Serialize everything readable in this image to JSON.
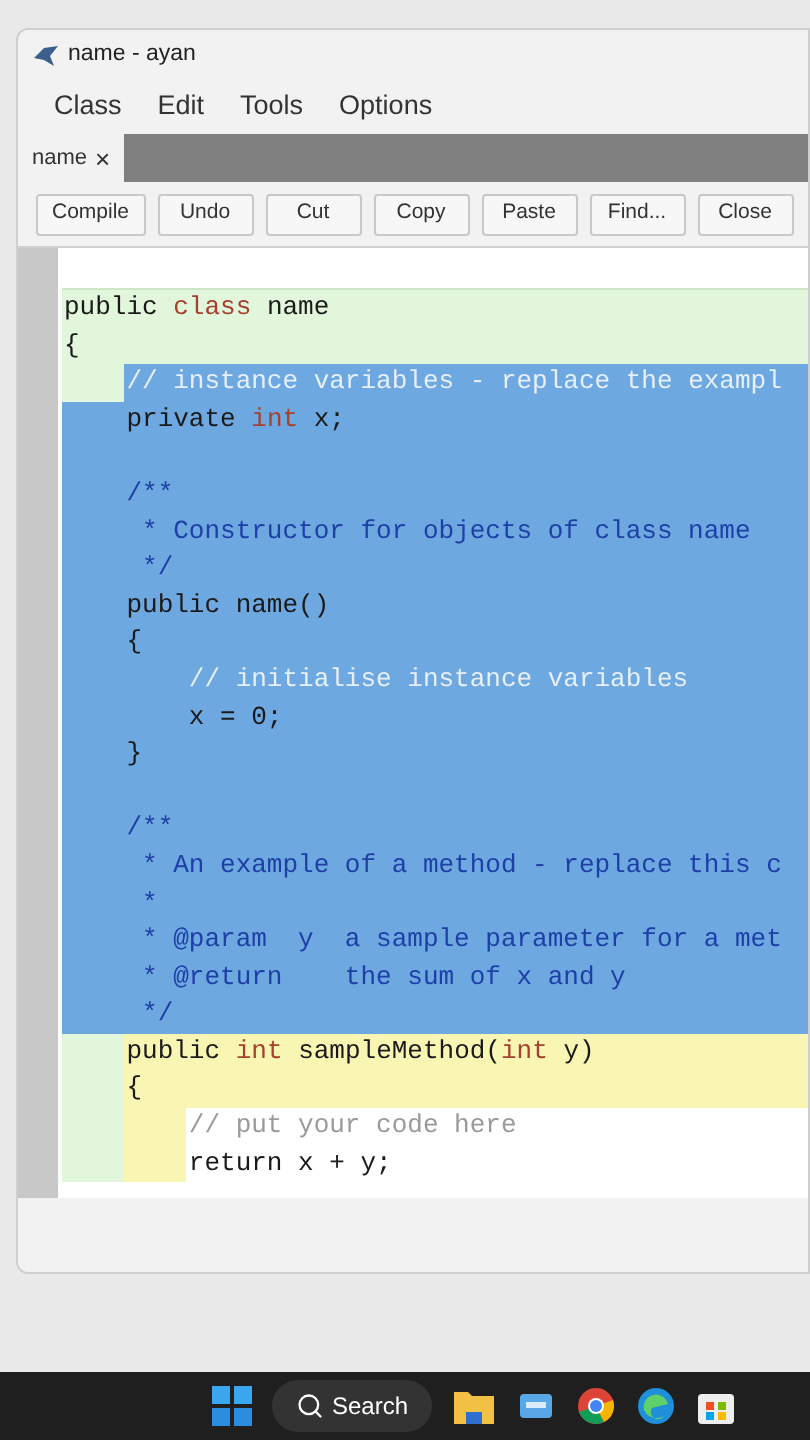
{
  "window": {
    "title": "name - ayan"
  },
  "menu": [
    "Class",
    "Edit",
    "Tools",
    "Options"
  ],
  "tabs": [
    {
      "label": "name",
      "close": "×",
      "selected": true
    }
  ],
  "toolbar": [
    "Compile",
    "Undo",
    "Cut",
    "Copy",
    "Paste",
    "Find...",
    "Close"
  ],
  "code": [
    {
      "kind": "class",
      "selected": false,
      "segments": [
        {
          "kind": "plain",
          "text": "public "
        },
        {
          "kind": "keyword",
          "text": "class"
        },
        {
          "kind": "plain",
          "text": " name"
        }
      ]
    },
    {
      "kind": "class",
      "selected": false,
      "segments": [
        {
          "kind": "plain",
          "text": "{"
        }
      ]
    },
    {
      "kind": "class",
      "selected": true,
      "segments": [
        {
          "kind": "faint",
          "text": "    // instance variables - replace the exampl"
        }
      ]
    },
    {
      "kind": "class",
      "selected": true,
      "segments": [
        {
          "kind": "plain",
          "text": "    private "
        },
        {
          "kind": "keyword",
          "text": "int"
        },
        {
          "kind": "plain",
          "text": " x;"
        }
      ]
    },
    {
      "kind": "class",
      "selected": true
    },
    {
      "kind": "class",
      "selected": true,
      "segments": [
        {
          "kind": "comment",
          "text": "    /**"
        }
      ]
    },
    {
      "kind": "class",
      "selected": true,
      "segments": [
        {
          "kind": "comment",
          "text": "     * Constructor for objects of class name"
        }
      ]
    },
    {
      "kind": "class",
      "selected": true,
      "segments": [
        {
          "kind": "comment",
          "text": "     */"
        }
      ]
    },
    {
      "kind": "class",
      "selected": true,
      "segments": [
        {
          "kind": "plain",
          "text": "    public name()"
        }
      ]
    },
    {
      "kind": "class",
      "selected": true,
      "segments": [
        {
          "kind": "plain",
          "text": "    {"
        }
      ]
    },
    {
      "kind": "class",
      "selected": true,
      "segments": [
        {
          "kind": "faint",
          "text": "        // initialise instance variables"
        }
      ]
    },
    {
      "kind": "class",
      "selected": true,
      "segments": [
        {
          "kind": "plain",
          "text": "        x = 0;"
        }
      ]
    },
    {
      "kind": "class",
      "selected": true,
      "segments": [
        {
          "kind": "plain",
          "text": "    }"
        }
      ]
    },
    {
      "kind": "class",
      "selected": true
    },
    {
      "kind": "class",
      "selected": true,
      "segments": [
        {
          "kind": "comment",
          "text": "    /**"
        }
      ]
    },
    {
      "kind": "class",
      "selected": true,
      "segments": [
        {
          "kind": "comment",
          "text": "     * An example of a method - replace this c"
        }
      ]
    },
    {
      "kind": "class",
      "selected": true,
      "segments": [
        {
          "kind": "comment",
          "text": "     *"
        }
      ]
    },
    {
      "kind": "class",
      "selected": true,
      "segments": [
        {
          "kind": "comment",
          "text": "     * @param  y  a sample parameter for a met"
        }
      ]
    },
    {
      "kind": "class",
      "selected": true,
      "segments": [
        {
          "kind": "comment",
          "text": "     * @return    the sum of x and y"
        }
      ]
    },
    {
      "kind": "method",
      "selected": true,
      "segments": [
        {
          "kind": "comment",
          "text": "     */"
        }
      ]
    },
    {
      "kind": "method",
      "selected": false,
      "segments": [
        {
          "kind": "plain",
          "text": "    public "
        },
        {
          "kind": "keyword",
          "text": "int"
        },
        {
          "kind": "plain",
          "text": " sampleMethod("
        },
        {
          "kind": "keyword",
          "text": "int"
        },
        {
          "kind": "plain",
          "text": " y)"
        }
      ]
    },
    {
      "kind": "method",
      "selected": false,
      "segments": [
        {
          "kind": "plain",
          "text": "    {"
        }
      ]
    },
    {
      "kind": "body",
      "selected": false,
      "segments": [
        {
          "kind": "note",
          "text": "        // put your code here"
        }
      ]
    },
    {
      "kind": "body",
      "selected": false,
      "segments": [
        {
          "kind": "plain",
          "text": "        return x + y;"
        }
      ]
    }
  ],
  "taskbar": {
    "search": "Search"
  }
}
